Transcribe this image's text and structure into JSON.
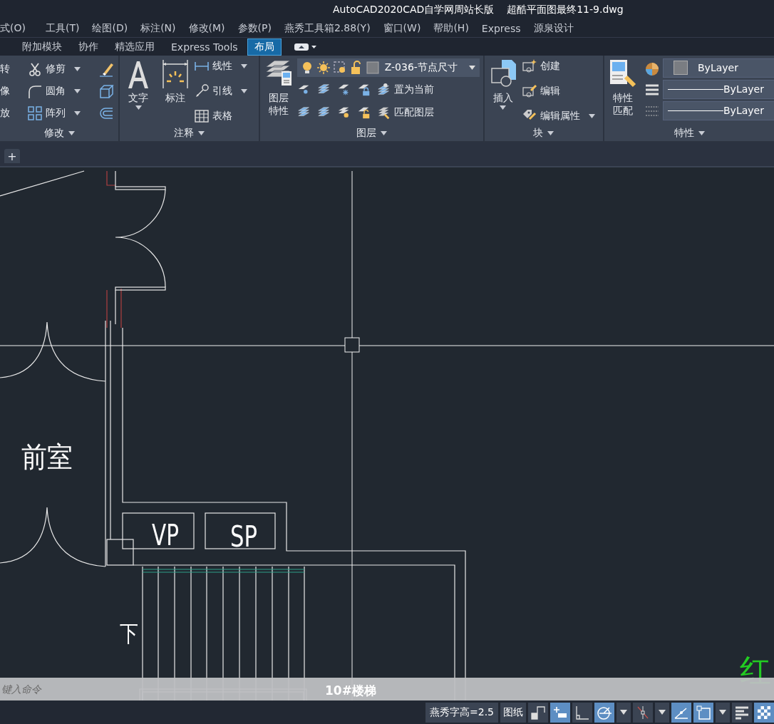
{
  "title_bar": {
    "title": "AutoCAD2020CAD自学网周站长版    超酷平面图最终11-9.dwg"
  },
  "menu_bar": [
    "式(O)",
    "工具(T)",
    "绘图(D)",
    "标注(N)",
    "修改(M)",
    "参数(P)",
    "燕秀工具箱2.88(Y)",
    "窗口(W)",
    "帮助(H)",
    "Express",
    "源泉设计"
  ],
  "ribbon_tabs": [
    {
      "label": "附加模块",
      "selected": false
    },
    {
      "label": "协作",
      "selected": false
    },
    {
      "label": "精选应用",
      "selected": false
    },
    {
      "label": "Express Tools",
      "selected": false
    },
    {
      "label": "布局",
      "selected": true
    }
  ],
  "ribbon_panels": [
    {
      "kind": "modify",
      "title": "修改",
      "rows": [
        [
          {
            "label": "转",
            "dropdown": false
          },
          {
            "label": "修剪",
            "dropdown": true
          }
        ],
        [
          {
            "label": "像",
            "dropdown": false
          },
          {
            "label": "圆角",
            "dropdown": true
          }
        ],
        [
          {
            "label": "放",
            "dropdown": false
          },
          {
            "label": "阵列",
            "dropdown": true
          }
        ]
      ]
    },
    {
      "kind": "annotation",
      "title": "注释",
      "large": [
        {
          "label": "文字",
          "dropdown": true
        },
        {
          "label": "标注",
          "dropdown": false
        }
      ],
      "small": [
        {
          "label": "线性",
          "dropdown": true
        },
        {
          "label": "引线",
          "dropdown": true
        },
        {
          "label": "表格",
          "dropdown": false
        }
      ]
    },
    {
      "kind": "layers",
      "title": "图层",
      "large": [
        {
          "label": "图层特性",
          "dropdown": false
        }
      ],
      "layer_dropdown": {
        "value": "Z-036-节点尺寸"
      },
      "small": [
        {
          "label": "置为当前",
          "dropdown": false
        },
        {
          "label": "匹配图层",
          "dropdown": false
        }
      ]
    },
    {
      "kind": "block",
      "title": "块",
      "large": [
        {
          "label": "插入",
          "dropdown": true
        }
      ],
      "small": [
        {
          "label": "创建",
          "dropdown": false
        },
        {
          "label": "编辑",
          "dropdown": false
        },
        {
          "label": "编辑属性",
          "dropdown": true
        }
      ]
    },
    {
      "kind": "properties",
      "title": "特性",
      "large": [
        {
          "label": "特性匹配",
          "dropdown": false
        }
      ],
      "fields": [
        {
          "kind": "color",
          "value": "ByLayer"
        },
        {
          "kind": "linetype",
          "value": "ByLayer"
        },
        {
          "kind": "lineweight",
          "value": "ByLayer"
        }
      ]
    }
  ],
  "file_tabs": {
    "new_tab": "+"
  },
  "drawing": {
    "labels": [
      "前室",
      "VP",
      "SP",
      "下",
      "10#楼梯",
      "红"
    ]
  },
  "command_line": {
    "placeholder": "键入命令"
  },
  "status_bar": {
    "text": "燕秀字高=2.5",
    "space_button": "图纸",
    "toggles": [
      {
        "kind": "toggle",
        "on": false
      },
      {
        "kind": "toggle",
        "on": true
      },
      {
        "kind": "toggle",
        "on": false
      },
      {
        "kind": "toggle",
        "on": true
      },
      {
        "kind": "caret",
        "on": false
      },
      {
        "kind": "toggle",
        "on": false
      },
      {
        "kind": "caret",
        "on": false
      },
      {
        "kind": "toggle",
        "on": true
      },
      {
        "kind": "toggle",
        "on": true
      },
      {
        "kind": "caret",
        "on": false
      },
      {
        "kind": "toggle",
        "on": false
      },
      {
        "kind": "toggle",
        "on": true
      }
    ]
  }
}
